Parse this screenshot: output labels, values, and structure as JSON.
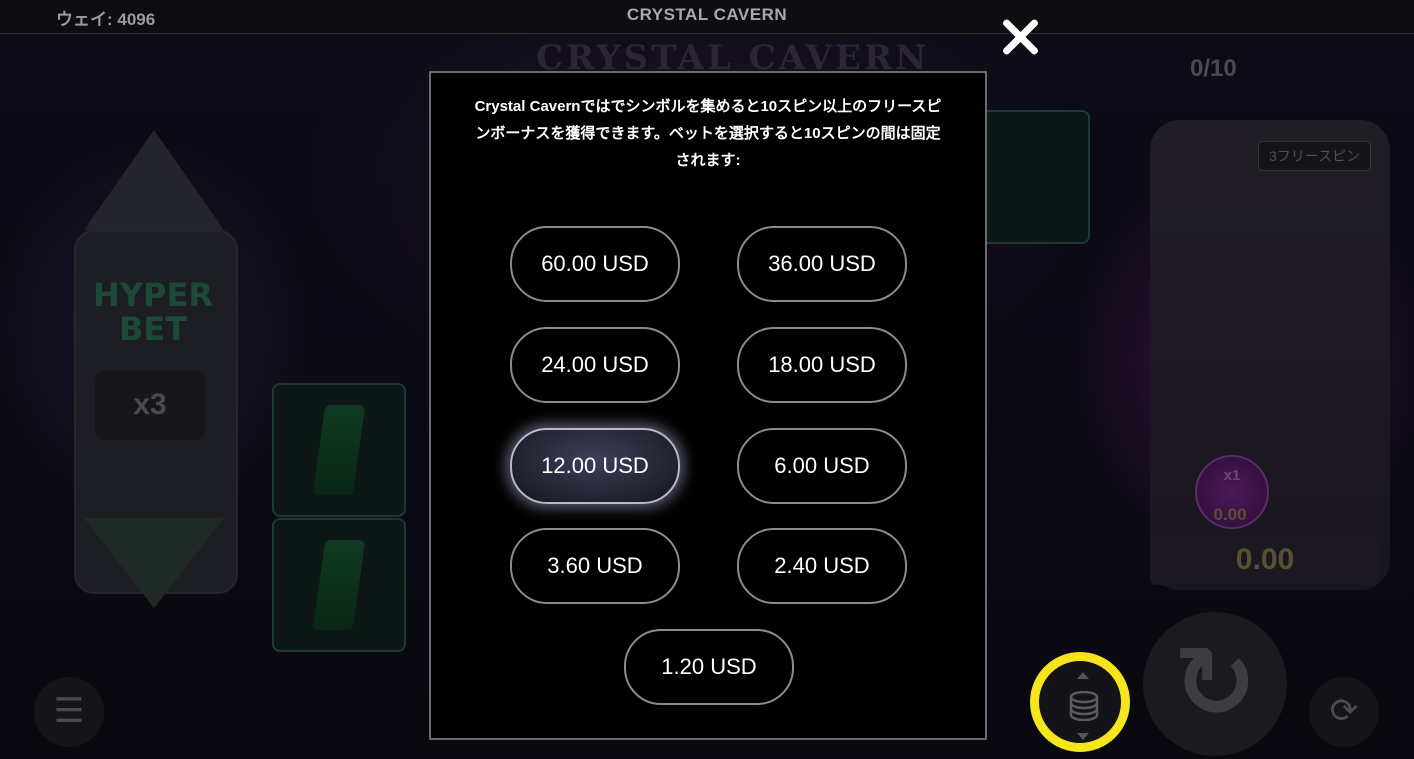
{
  "topbar": {
    "ways_text": "ウェイ: 4096",
    "title": "CRYSTAL CAVERN"
  },
  "background": {
    "logo_text": "CRYSTAL CAVERN",
    "hyper_bet_text": "HYPER BET",
    "multiplier_text": "x3",
    "free_spin_count": "0/10",
    "free_spin_tag": "3フリースピン",
    "orb_multiplier": "x1",
    "orb_value": "0.00",
    "win_value": "0.00"
  },
  "bet_panel": {
    "description": "Crystal Cavernではでシンボルを集めると10スピン以上のフリースピンボーナスを獲得できます。ベットを選択すると10スピンの間は固定されます:",
    "options": [
      {
        "label": "60.00 USD",
        "selected": false
      },
      {
        "label": "36.00 USD",
        "selected": false
      },
      {
        "label": "24.00 USD",
        "selected": false
      },
      {
        "label": "18.00 USD",
        "selected": false
      },
      {
        "label": "12.00 USD",
        "selected": true
      },
      {
        "label": "6.00 USD",
        "selected": false
      },
      {
        "label": "3.60 USD",
        "selected": false
      },
      {
        "label": "2.40 USD",
        "selected": false
      },
      {
        "label": "1.20 USD",
        "selected": false
      }
    ]
  },
  "icons": {
    "close": "close-icon",
    "menu": "menu-icon",
    "bet_stack": "coin-stack-icon",
    "spin": "spin-icon",
    "autoplay": "autoplay-icon"
  },
  "colors": {
    "highlight_ring": "#f5e51a",
    "selected_glow": "#c8cdff"
  }
}
